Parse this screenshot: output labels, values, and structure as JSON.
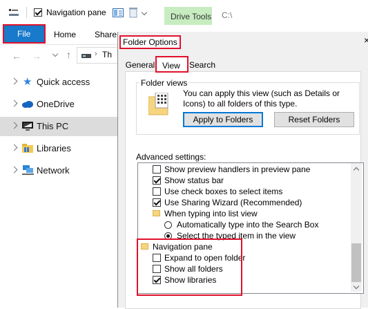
{
  "qat": {
    "checkbox_label": "Navigation pane",
    "context_tab": "Drive Tools",
    "path": "C:\\"
  },
  "ribbon": {
    "file": "File",
    "home": "Home",
    "share": "Share"
  },
  "address": {
    "crumb": "Th"
  },
  "sidebar": {
    "items": [
      {
        "label": "Quick access"
      },
      {
        "label": "OneDrive"
      },
      {
        "label": "This PC"
      },
      {
        "label": "Libraries"
      },
      {
        "label": "Network"
      }
    ]
  },
  "dialog": {
    "title": "Folder Options",
    "close_glyph": "×",
    "tabs": [
      "General",
      "View",
      "Search"
    ],
    "folder_views": {
      "legend": "Folder views",
      "description": "You can apply this view (such as Details or Icons) to all folders of this type.",
      "apply": "Apply to Folders",
      "reset": "Reset Folders"
    },
    "advanced_label": "Advanced settings:",
    "settings": [
      {
        "label": "Show preview handlers in preview pane",
        "checked": false
      },
      {
        "label": "Show status bar",
        "checked": true
      },
      {
        "label": "Use check boxes to select items",
        "checked": false
      },
      {
        "label": "Use Sharing Wizard (Recommended)",
        "checked": true
      }
    ],
    "typing_group": "When typing into list view",
    "radios": [
      {
        "label": "Automatically type into the Search Box",
        "selected": false
      },
      {
        "label": "Select the typed item in the view",
        "selected": true
      }
    ],
    "nav_group": "Navigation pane",
    "nav_settings": [
      {
        "label": "Expand to open folder",
        "checked": false
      },
      {
        "label": "Show all folders",
        "checked": false
      },
      {
        "label": "Show libraries",
        "checked": true
      }
    ]
  },
  "colors": {
    "file_blue": "#1979ca",
    "highlight_red": "#e0102b",
    "drive_tools_green": "#c7ecc0"
  }
}
